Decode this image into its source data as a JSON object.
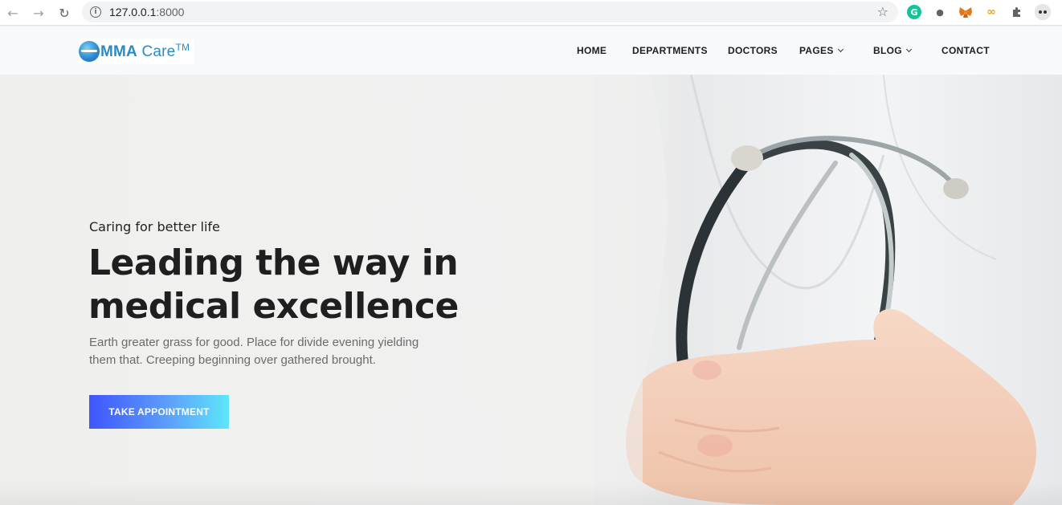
{
  "browser": {
    "url_host": "127.0.0.1",
    "url_port": ":8000",
    "back_icon": "arrow-left-icon",
    "forward_icon": "arrow-right-icon",
    "reload_icon": "reload-icon",
    "info_icon": "info-icon",
    "bookmark_icon": "star-icon",
    "extensions": [
      "grammarly-icon",
      "maps-pin-icon",
      "metamask-fox-icon",
      "infinity-ext-icon",
      "puzzle-extensions-icon",
      "profile-avatar-icon"
    ]
  },
  "site": {
    "logo": {
      "brand_bold": "MMA",
      "brand_rest": " Care",
      "trademark": "TM"
    },
    "menu": [
      {
        "label": "HOME"
      },
      {
        "label": "DEPARTMENTS"
      },
      {
        "label": "DOCTORS"
      },
      {
        "label": "PAGES",
        "dropdown": true
      },
      {
        "label": "BLOG",
        "dropdown": true
      },
      {
        "label": "CONTACT"
      }
    ]
  },
  "hero": {
    "subtitle": "Caring for better life",
    "headline_line1": "Leading the way in",
    "headline_line2": "medical excellence",
    "description": "Earth greater grass for good. Place for divide evening yielding them that. Creeping beginning over gathered brought.",
    "cta_label": "TAKE APPOINTMENT",
    "image": "doctor-stethoscope-photo"
  },
  "colors": {
    "brand_blue": "#2a8ac8",
    "cta_start": "#3f55ff",
    "cta_end": "#5fe6fb",
    "text_dark": "#1f1f1f",
    "text_muted": "#6b6b6b"
  }
}
